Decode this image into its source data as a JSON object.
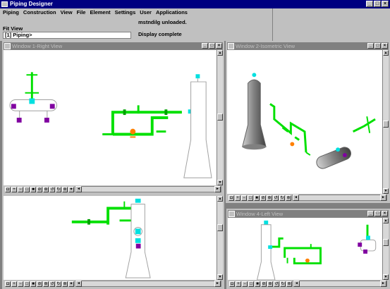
{
  "app": {
    "title": "Piping Designer",
    "controls": [
      "_",
      "□",
      "×"
    ]
  },
  "menu": {
    "items": [
      "Piping",
      "Construction",
      "View",
      "File",
      "Element",
      "Settings",
      "User",
      "Applications"
    ]
  },
  "command": {
    "current": "Fit View",
    "input_value": "[1] Piping>",
    "message_top": "mstndilg unloaded.",
    "message_bottom": "Display complete"
  },
  "windows": {
    "w1": {
      "title": "Window 1-Right View"
    },
    "w2": {
      "title": "Window 2-Isometric View"
    },
    "w3": {
      "title": "Window 3"
    },
    "w4": {
      "title": "Window 4-Left View"
    }
  },
  "toolbar": {
    "buttons": [
      "◘",
      "+",
      "−",
      "□",
      "■",
      "⊘",
      "⊛",
      "↺",
      "↻",
      "⊚",
      "✦"
    ]
  },
  "colors": {
    "pipe_green": "#00e000",
    "pipe_dark_green": "#00a000",
    "cyan": "#00e0e0",
    "purple": "#8000a0",
    "orange": "#ff8000",
    "title_blue": "#000080",
    "vessel_gray": "#a0a0a0"
  }
}
